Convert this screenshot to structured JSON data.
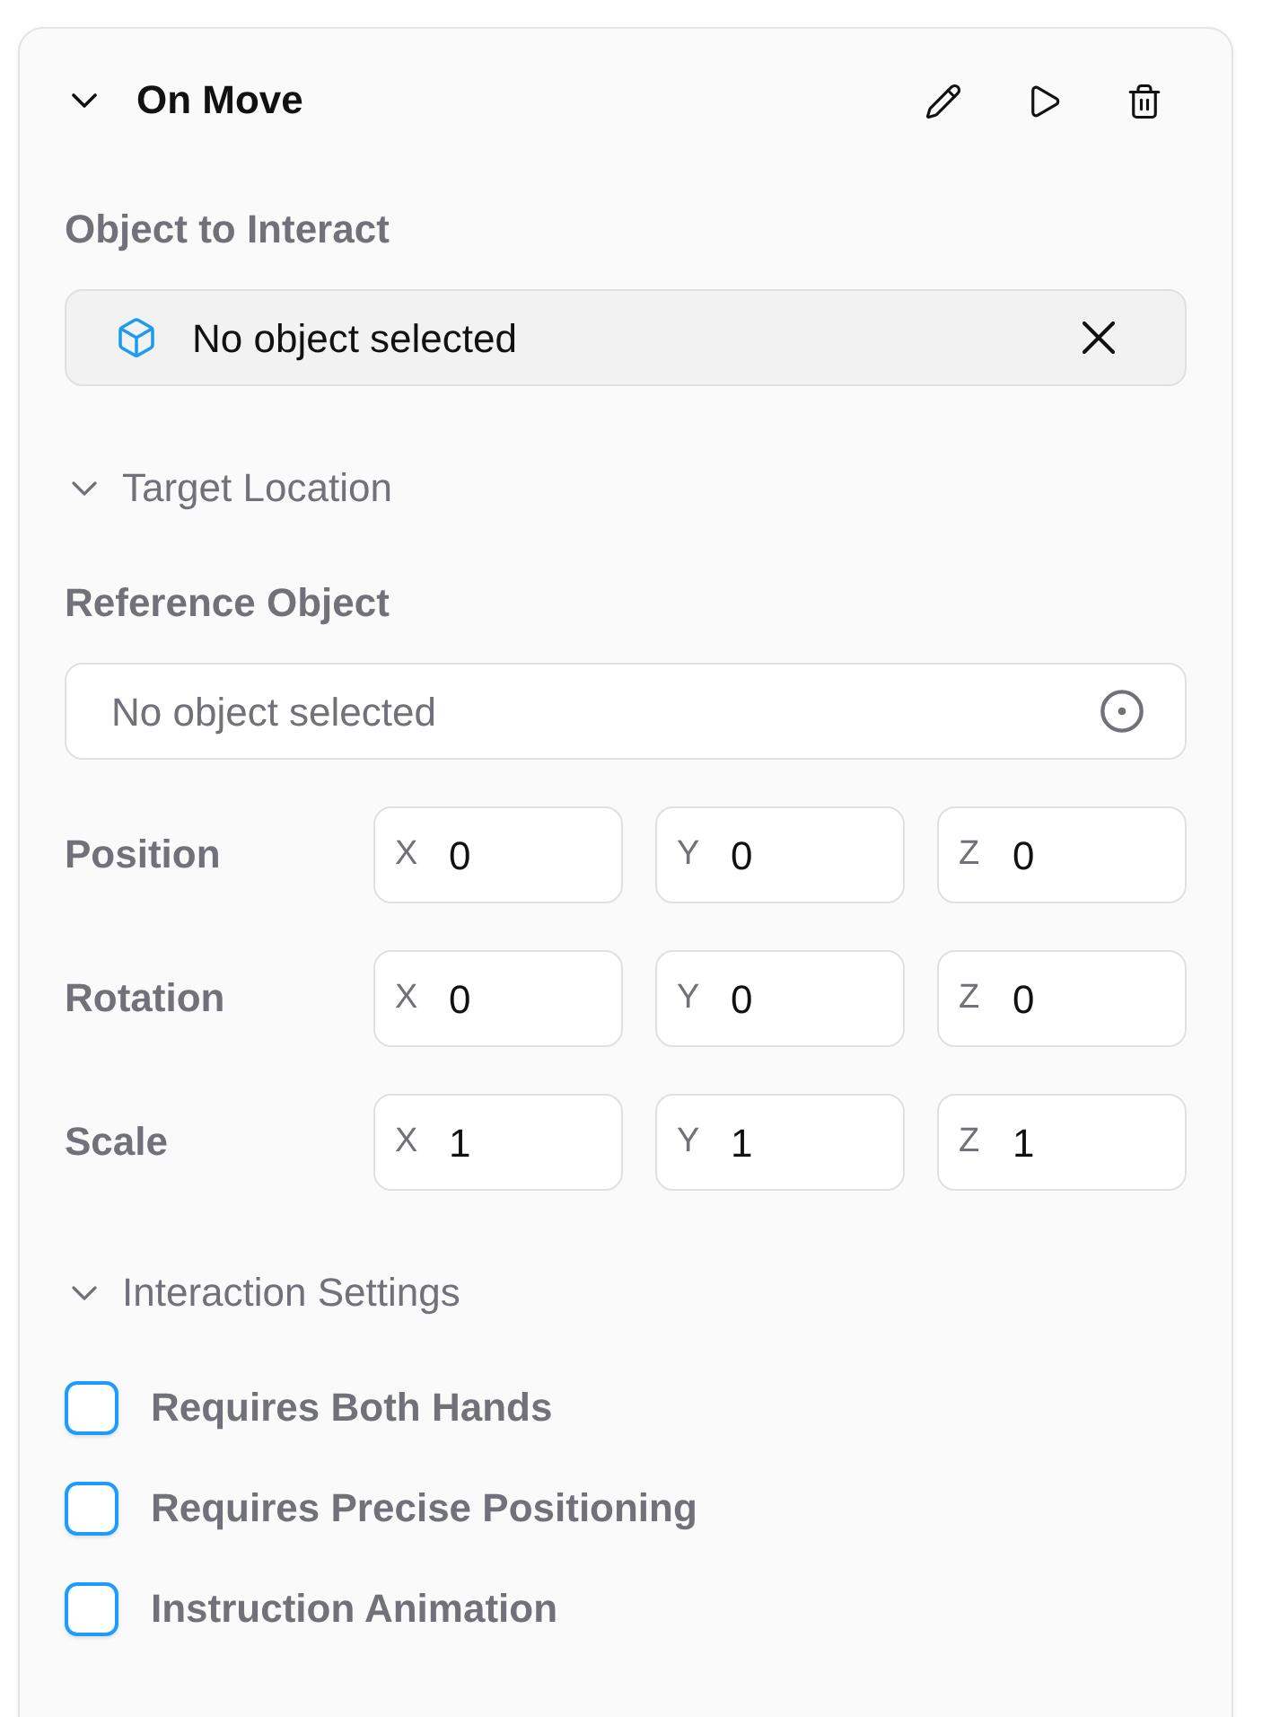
{
  "card": {
    "title": "On Move",
    "expanded": true
  },
  "object_to_interact": {
    "label": "Object to Interact",
    "value": "No object selected"
  },
  "target_location": {
    "title": "Target Location",
    "expanded": true,
    "reference_object": {
      "label": "Reference Object",
      "placeholder": "No object selected"
    },
    "transforms": [
      {
        "label": "Position",
        "axes": [
          {
            "axis": "X",
            "value": "0"
          },
          {
            "axis": "Y",
            "value": "0"
          },
          {
            "axis": "Z",
            "value": "0"
          }
        ]
      },
      {
        "label": "Rotation",
        "axes": [
          {
            "axis": "X",
            "value": "0"
          },
          {
            "axis": "Y",
            "value": "0"
          },
          {
            "axis": "Z",
            "value": "0"
          }
        ]
      },
      {
        "label": "Scale",
        "axes": [
          {
            "axis": "X",
            "value": "1"
          },
          {
            "axis": "Y",
            "value": "1"
          },
          {
            "axis": "Z",
            "value": "1"
          }
        ]
      }
    ]
  },
  "interaction_settings": {
    "title": "Interaction Settings",
    "expanded": true,
    "options": [
      {
        "label": "Requires Both Hands",
        "checked": false
      },
      {
        "label": "Requires Precise Positioning",
        "checked": false
      },
      {
        "label": "Instruction Animation",
        "checked": false
      }
    ]
  }
}
